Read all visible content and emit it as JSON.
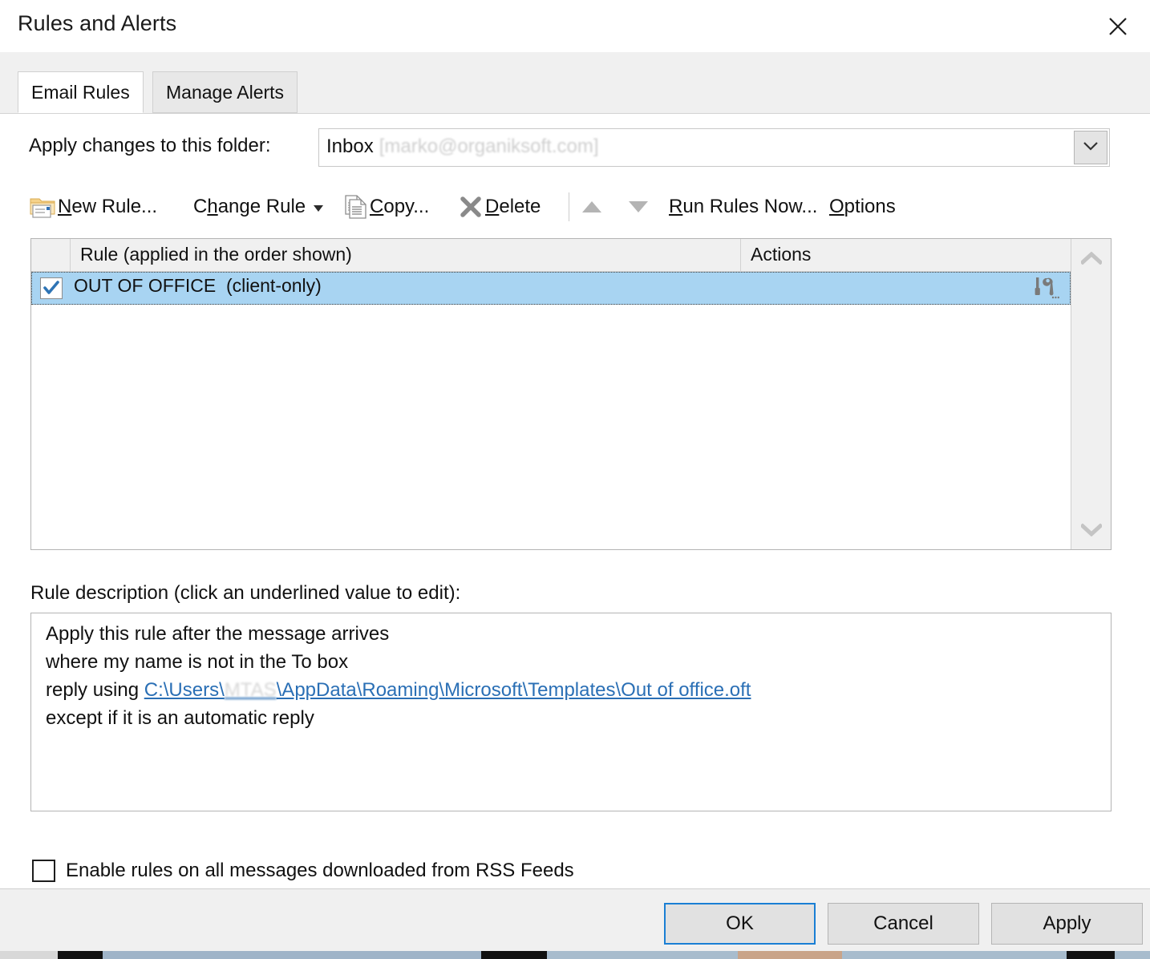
{
  "window": {
    "title": "Rules and Alerts",
    "close_icon": "close-icon"
  },
  "tabs": [
    {
      "label": "Email Rules",
      "active": true
    },
    {
      "label": "Manage Alerts",
      "active": false
    }
  ],
  "folder": {
    "label": "Apply changes to this folder:",
    "value": "Inbox",
    "value_suffix": "[marko@organiksoft.com]",
    "dropdown_icon": "chevron-down-icon"
  },
  "toolbar": {
    "new_rule": {
      "label": "New Rule...",
      "accel": "N",
      "icon": "new-rule-folder-icon"
    },
    "change_rule": {
      "label": "Change Rule",
      "accel": "h",
      "icon": "chevron-down-icon"
    },
    "copy": {
      "label": "Copy...",
      "accel": "C",
      "icon": "copy-pages-icon"
    },
    "delete": {
      "label": "Delete",
      "accel": "D",
      "icon": "delete-x-icon"
    },
    "move_up": {
      "icon": "arrow-up-icon"
    },
    "move_down": {
      "icon": "arrow-down-icon"
    },
    "run_rules_now": {
      "label": "Run Rules Now...",
      "accel": "R"
    },
    "options": {
      "label": "Options",
      "accel": "O"
    }
  },
  "rules_list": {
    "headers": {
      "checkbox": "",
      "rule": "Rule (applied in the order shown)",
      "actions": "Actions"
    },
    "rows": [
      {
        "checked": true,
        "name": "OUT OF OFFICE  (client-only)",
        "actions_icon": "tools-wrench-screwdriver-icon",
        "selected": true
      }
    ],
    "scrollbar": {
      "up_icon": "chevron-up-icon",
      "down_icon": "chevron-down-icon"
    }
  },
  "description": {
    "label": "Rule description (click an underlined value to edit):",
    "lines": [
      {
        "text": "Apply this rule after the message arrives",
        "link": false
      },
      {
        "text": "where my name is not in the To box",
        "link": false
      },
      {
        "text": "reply using ",
        "link": true,
        "link_prefix": "C:\\Users\\",
        "link_redacted": "MTAS",
        "link_suffix": "\\AppData\\Roaming\\Microsoft\\Templates\\Out of office.oft"
      },
      {
        "text": "except if it is an automatic reply",
        "link": false
      }
    ]
  },
  "rss": {
    "label": "Enable rules on all messages downloaded from RSS Feeds",
    "checked": false
  },
  "footer": {
    "ok": "OK",
    "cancel": "Cancel",
    "apply": "Apply"
  },
  "colors": {
    "selection": "#a8d4f2",
    "link": "#2a6fb5",
    "focus_border": "#1a7fd4",
    "chrome": "#f0f0f0"
  }
}
